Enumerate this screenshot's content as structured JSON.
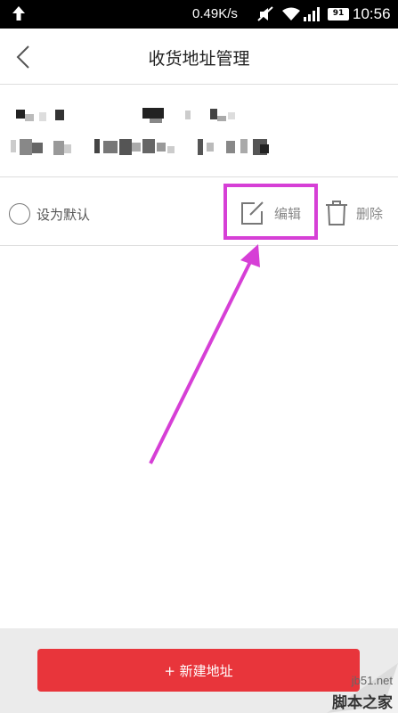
{
  "status_bar": {
    "net_speed": "0.49K/s",
    "battery": "91",
    "time": "10:56",
    "icons": [
      "upload-arrow-icon",
      "mute-icon",
      "wifi-icon",
      "signal-icon",
      "battery-icon"
    ]
  },
  "header": {
    "title": "收货地址管理",
    "back_icon": "chevron-left-icon"
  },
  "address": {
    "set_default_label": "设为默认",
    "edit_label": "编辑",
    "delete_label": "删除"
  },
  "footer": {
    "new_address_label": "+ 新建地址"
  },
  "watermark": {
    "site": "jb51.net",
    "name": "脚本之家"
  },
  "colors": {
    "primary_button": "#e8353b",
    "annotation": "#d63fd6",
    "status_bar": "#000000"
  }
}
